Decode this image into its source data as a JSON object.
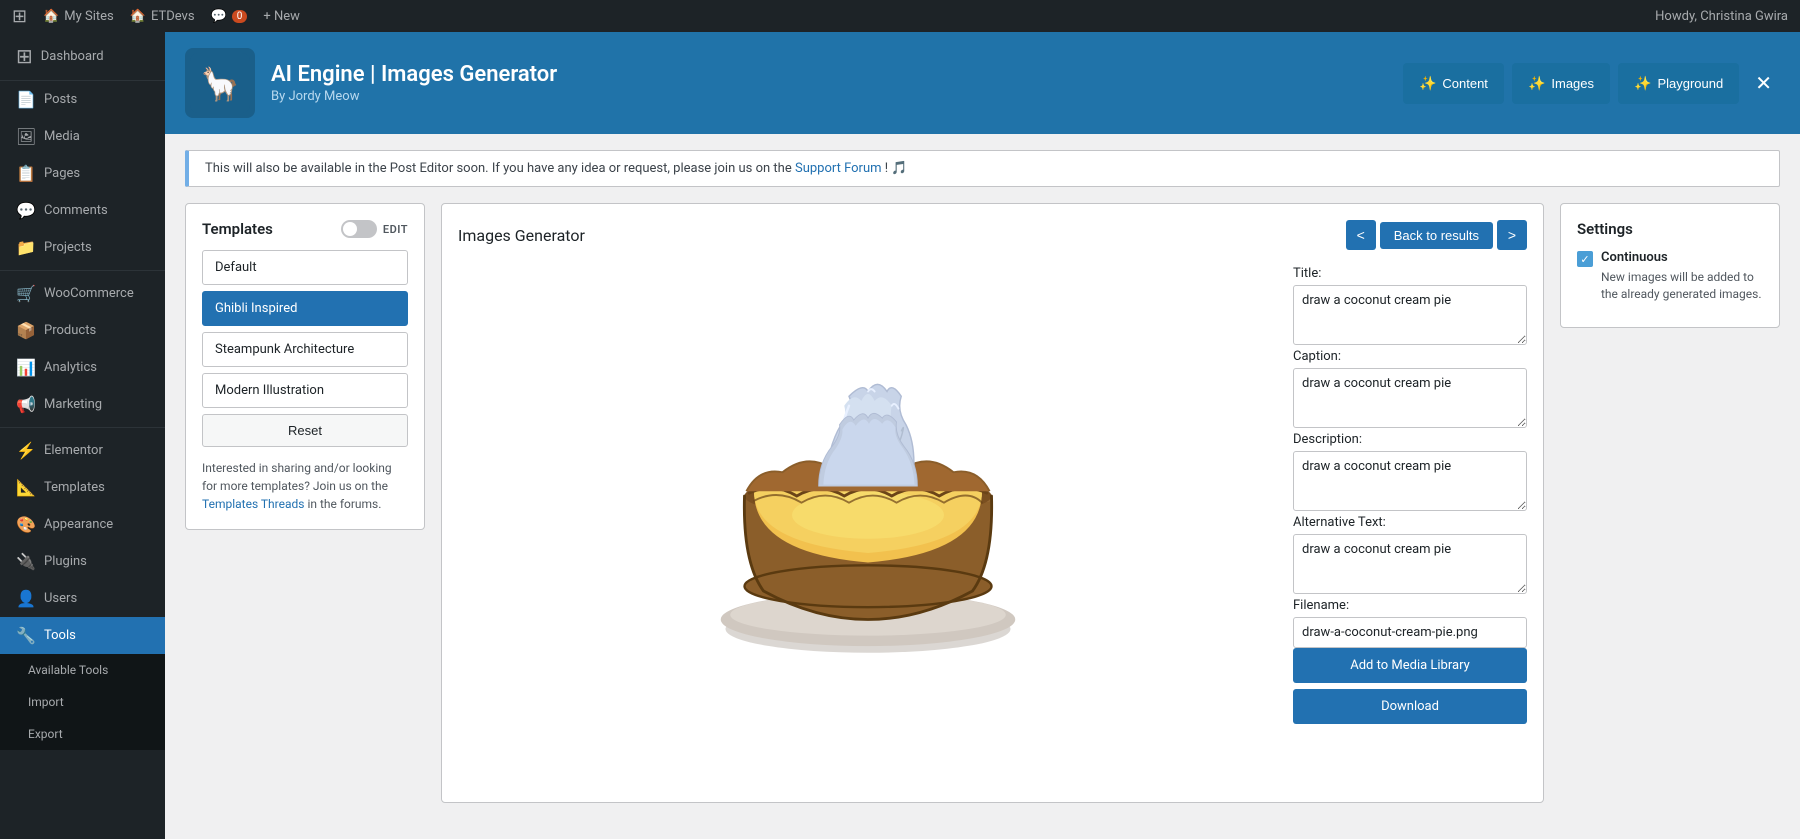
{
  "adminbar": {
    "wp_logo": "⊞",
    "my_sites_label": "My Sites",
    "site_label": "ETDevs",
    "comments_label": "0",
    "new_label": "+ New",
    "user_greeting": "Howdy, Christina Gwira",
    "dashboard_label": "Dashboard"
  },
  "sidebar": {
    "logo_label": "My Sites Dashboard",
    "items": [
      {
        "id": "posts",
        "label": "Posts",
        "icon": "📄"
      },
      {
        "id": "media",
        "label": "Media",
        "icon": "🖼"
      },
      {
        "id": "pages",
        "label": "Pages",
        "icon": "📋"
      },
      {
        "id": "comments",
        "label": "Comments",
        "icon": "💬"
      },
      {
        "id": "projects",
        "label": "Projects",
        "icon": "📁"
      },
      {
        "id": "woocommerce",
        "label": "WooCommerce",
        "icon": "🛒"
      },
      {
        "id": "products",
        "label": "Products",
        "icon": "📦"
      },
      {
        "id": "analytics",
        "label": "Analytics",
        "icon": "📊"
      },
      {
        "id": "marketing",
        "label": "Marketing",
        "icon": "📢"
      },
      {
        "id": "elementor",
        "label": "Elementor",
        "icon": "⚡"
      },
      {
        "id": "templates",
        "label": "Templates",
        "icon": "📐"
      },
      {
        "id": "appearance",
        "label": "Appearance",
        "icon": "🎨"
      },
      {
        "id": "plugins",
        "label": "Plugins",
        "icon": "🔌"
      },
      {
        "id": "users",
        "label": "Users",
        "icon": "👤"
      },
      {
        "id": "tools",
        "label": "Tools",
        "icon": "🔧"
      }
    ],
    "submenu": {
      "available_tools": "Available Tools",
      "import": "Import",
      "export": "Export"
    }
  },
  "plugin_header": {
    "title": "AI Engine | Images Generator",
    "subtitle": "By Jordy Meow",
    "nav_content": "Content",
    "nav_images": "Images",
    "nav_playground": "Playground",
    "logo_emoji": "🦙"
  },
  "info_bar": {
    "text": "This will also be available in the Post Editor soon. If you have any idea or request, please join us on the",
    "link_text": "Support Forum",
    "suffix": "! 🎵"
  },
  "templates_panel": {
    "title": "Templates",
    "edit_label": "EDIT",
    "items": [
      {
        "id": "default",
        "label": "Default",
        "active": false
      },
      {
        "id": "ghibli",
        "label": "Ghibli Inspired",
        "active": true
      },
      {
        "id": "steampunk",
        "label": "Steampunk Architecture",
        "active": false
      },
      {
        "id": "modern",
        "label": "Modern Illustration",
        "active": false
      }
    ],
    "reset_label": "Reset",
    "footer_text": "Interested in sharing and/or looking for more templates? Join us on the",
    "footer_link": "Templates Threads",
    "footer_suffix": " in the forums."
  },
  "generator_panel": {
    "title": "Images Generator",
    "nav_prev": "<",
    "nav_back": "Back to results",
    "nav_next": ">"
  },
  "form": {
    "title_label": "Title:",
    "title_value": "draw a coconut cream pie",
    "caption_label": "Caption:",
    "caption_value": "draw a coconut cream pie",
    "description_label": "Description:",
    "description_value": "draw a coconut cream pie",
    "alt_label": "Alternative Text:",
    "alt_value": "draw a coconut cream pie",
    "filename_label": "Filename:",
    "filename_value": "draw-a-coconut-cream-pie.png",
    "add_media_label": "Add to Media Library",
    "download_label": "Download"
  },
  "settings_panel": {
    "title": "Settings",
    "continuous_label": "Continuous",
    "continuous_desc": "New images will be added to the already generated images."
  }
}
